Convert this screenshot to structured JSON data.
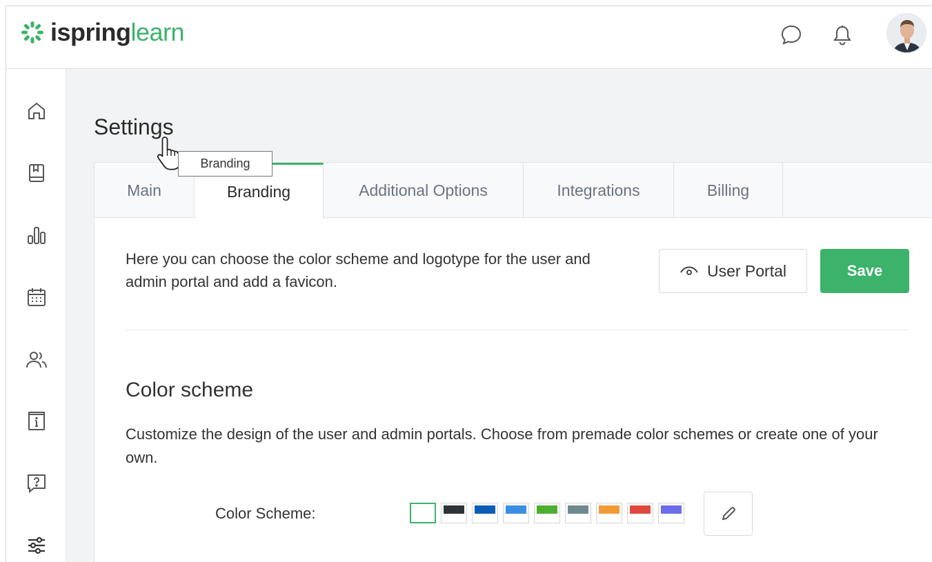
{
  "app": {
    "logo_brand": "ispring",
    "logo_product": "learn",
    "brand_color": "#3cb26a"
  },
  "header": {
    "icons": [
      "chat-icon",
      "bell-icon",
      "user-avatar"
    ]
  },
  "sidebar": {
    "items": [
      {
        "name": "home",
        "icon": "home-icon"
      },
      {
        "name": "content",
        "icon": "book-icon"
      },
      {
        "name": "reports",
        "icon": "bar-chart-icon"
      },
      {
        "name": "calendar",
        "icon": "calendar-icon"
      },
      {
        "name": "users",
        "icon": "users-icon"
      },
      {
        "name": "info",
        "icon": "info-page-icon"
      },
      {
        "name": "help",
        "icon": "question-bubble-icon"
      },
      {
        "name": "settings",
        "icon": "sliders-icon",
        "active": true
      }
    ]
  },
  "page": {
    "title": "Settings"
  },
  "tabs": [
    {
      "label": "Main",
      "active": false
    },
    {
      "label": "Branding",
      "active": true
    },
    {
      "label": "Additional Options",
      "active": false
    },
    {
      "label": "Integrations",
      "active": false
    },
    {
      "label": "Billing",
      "active": false
    }
  ],
  "tooltip": {
    "text": "Branding"
  },
  "branding": {
    "intro": "Here you can choose the color scheme and logotype for the user and admin portal and add a favicon.",
    "user_portal_label": "User Portal",
    "save_label": "Save",
    "color_scheme": {
      "title": "Color scheme",
      "description": "Customize the design of the user and admin portals. Choose from premade color schemes or create one of your own.",
      "field_label": "Color Scheme:",
      "selected_index": 0,
      "swatches": [
        "#ffffff",
        "#2e3338",
        "#0a5fb4",
        "#3a8ee6",
        "#4caf2e",
        "#6f8a8e",
        "#f29a38",
        "#e0483d",
        "#6b6ee8"
      ]
    }
  }
}
